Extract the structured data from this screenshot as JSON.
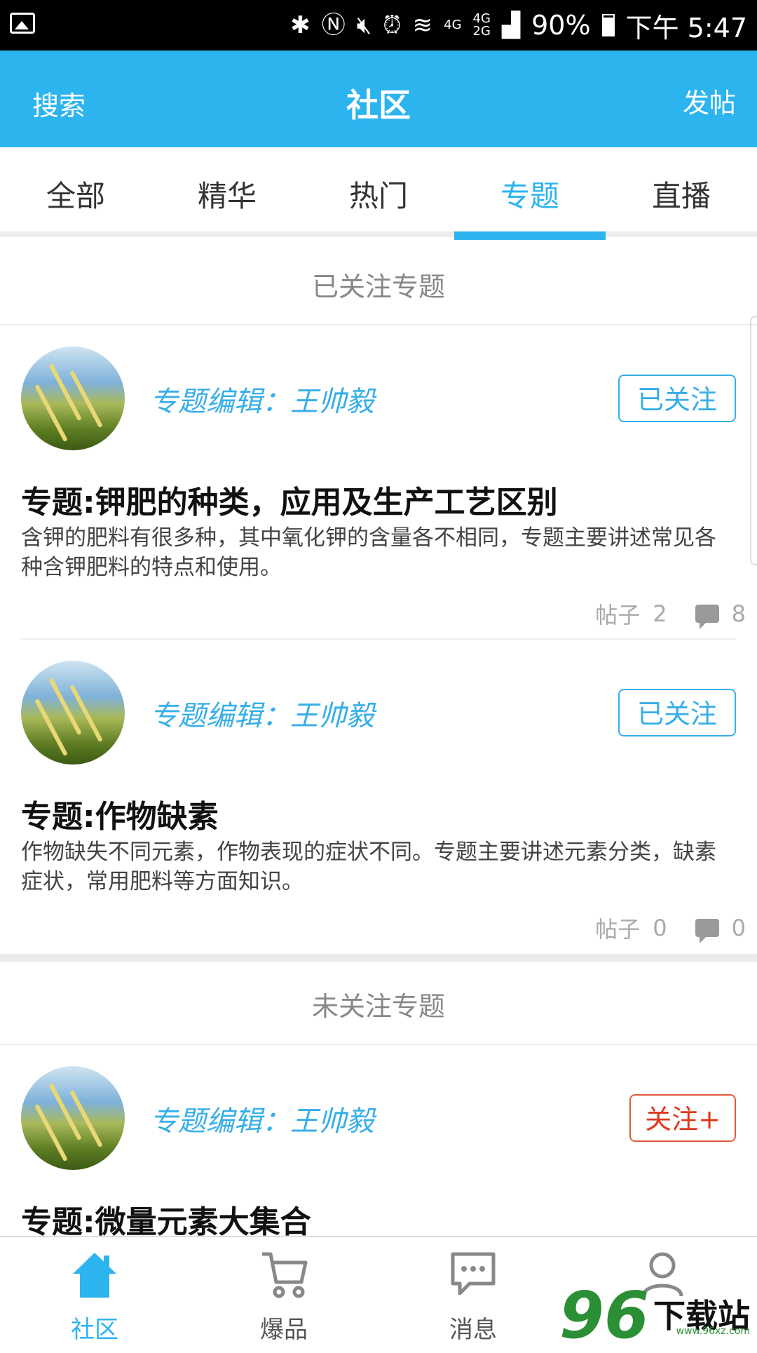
{
  "status_bar": {
    "battery": "90%",
    "time": "下午 5:47",
    "net_top": "4G",
    "net_mid": "4G",
    "net_bottom": "2G",
    "icons": [
      "gallery-icon",
      "bluetooth-icon",
      "nfc-icon",
      "mute-icon",
      "alarm-icon",
      "wifi-icon",
      "signal-icon",
      "battery-icon"
    ]
  },
  "header": {
    "left": "搜索",
    "title": "社区",
    "right": "发帖",
    "bg_color": "#2cb4ef"
  },
  "tabs": [
    {
      "label": "全部"
    },
    {
      "label": "精华"
    },
    {
      "label": "热门"
    },
    {
      "label": "专题",
      "active": true
    },
    {
      "label": "直播"
    }
  ],
  "followed_section": {
    "title": "已关注专题",
    "items": [
      {
        "editor": "专题编辑：王帅毅",
        "button": "已关注",
        "title": "专题:钾肥的种类，应用及生产工艺区别",
        "desc": "含钾的肥料有很多种，其中氧化钾的含量各不相同，专题主要讲述常见各种含钾肥料的特点和使用。",
        "posts_label": "帖子",
        "posts": "2",
        "comments": "8"
      },
      {
        "editor": "专题编辑：王帅毅",
        "button": "已关注",
        "title": "专题:作物缺素",
        "desc": "作物缺失不同元素，作物表现的症状不同。专题主要讲述元素分类，缺素症状，常用肥料等方面知识。",
        "posts_label": "帖子",
        "posts": "0",
        "comments": "0"
      }
    ]
  },
  "unfollowed_section": {
    "title": "未关注专题",
    "items": [
      {
        "editor": "专题编辑：王帅毅",
        "button": "关注+",
        "title": "专题:微量元素大集合"
      }
    ]
  },
  "bottom_nav": [
    {
      "label": "社区",
      "icon": "home-icon",
      "active": true
    },
    {
      "label": "爆品",
      "icon": "cart-icon"
    },
    {
      "label": "消息",
      "icon": "message-icon"
    },
    {
      "label": "",
      "icon": "user-icon"
    }
  ],
  "watermark": {
    "number": "96",
    "text": "下载站",
    "url": "www.96xz.com"
  },
  "colors": {
    "accent": "#2cb4ef",
    "follow_red": "#e0391d"
  }
}
